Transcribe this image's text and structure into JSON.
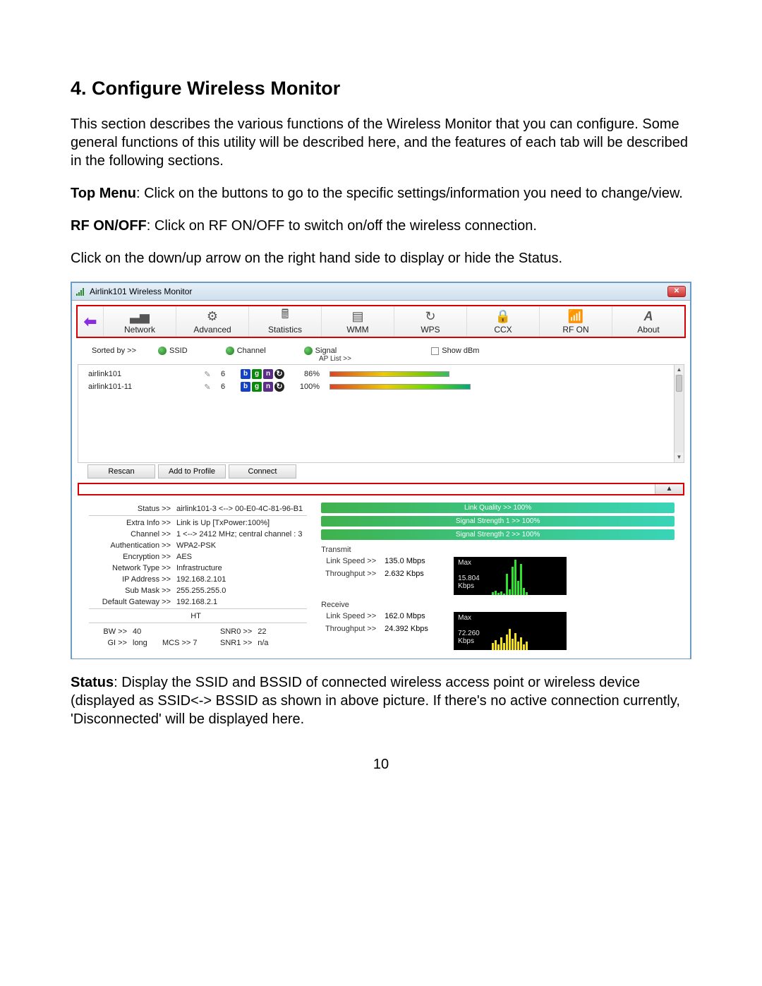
{
  "page": {
    "heading": "4. Configure Wireless Monitor",
    "p1": "This section describes the various functions of the Wireless Monitor that you can configure. Some general functions of this utility will be described here, and the features of each tab will be described in the following sections.",
    "p2_b": "Top Menu",
    "p2": ": Click on the buttons to go to the specific settings/information you need to change/view.",
    "p3_b": "RF ON/OFF",
    "p3": ": Click on RF ON/OFF to switch on/off the wireless connection.",
    "p4": "Click on the down/up arrow on the right hand side to display or hide the Status.",
    "p5_b": "Status",
    "p5": ": Display the SSID and BSSID of connected wireless access point or wireless device (displayed as SSID<-> BSSID as shown in above picture. If there's no active connection currently, 'Disconnected' will be displayed here.",
    "page_number": "10"
  },
  "app": {
    "title": "Airlink101 Wireless Monitor",
    "close": "✕",
    "back": "⬅",
    "toolbar": {
      "network": "Network",
      "advanced": "Advanced",
      "statistics": "Statistics",
      "wmm": "WMM",
      "wps": "WPS",
      "ccx": "CCX",
      "rfon": "RF ON",
      "about": "About"
    },
    "sort": {
      "label": "Sorted by >>",
      "ssid": "SSID",
      "channel": "Channel",
      "signal": "Signal",
      "show_dbm": "Show dBm",
      "aplist": "AP List >>"
    },
    "ap": [
      {
        "ssid": "airlink101",
        "ch": "6",
        "pct": "86%"
      },
      {
        "ssid": "airlink101-11",
        "ch": "6",
        "pct": "100%"
      }
    ],
    "btns": {
      "rescan": "Rescan",
      "add": "Add to Profile",
      "connect": "Connect"
    },
    "collapse": "▲",
    "status": {
      "status_k": "Status >>",
      "status_v": "airlink101-3 <--> 00-E0-4C-81-96-B1",
      "extra_k": "Extra Info >>",
      "extra_v": "Link is Up [TxPower:100%]",
      "channel_k": "Channel >>",
      "channel_v": "1 <--> 2412 MHz; central channel : 3",
      "auth_k": "Authentication >>",
      "auth_v": "WPA2-PSK",
      "enc_k": "Encryption >>",
      "enc_v": "AES",
      "net_k": "Network Type >>",
      "net_v": "Infrastructure",
      "ip_k": "IP Address >>",
      "ip_v": "192.168.2.101",
      "mask_k": "Sub Mask >>",
      "mask_v": "255.255.255.0",
      "gw_k": "Default Gateway >>",
      "gw_v": "192.168.2.1",
      "ht": "HT",
      "bw_k": "BW >>",
      "bw_v": "40",
      "gi_k": "GI >>",
      "gi_v": "long",
      "mcs_k": "MCS >>",
      "mcs_v": "7",
      "snr0_k": "SNR0 >>",
      "snr0_v": "22",
      "snr1_k": "SNR1 >>",
      "snr1_v": "n/a"
    },
    "quality": {
      "link": "Link Quality >> 100%",
      "s1": "Signal Strength 1 >> 100%",
      "s2": "Signal Strength 2 >> 100%"
    },
    "transmit": {
      "label": "Transmit",
      "ls_k": "Link Speed >>",
      "ls_v": "135.0 Mbps",
      "tp_k": "Throughput >>",
      "tp_v": "2.632 Kbps",
      "chart_top": "Max",
      "chart_val": "15.804",
      "chart_unit": "Kbps"
    },
    "receive": {
      "label": "Receive",
      "ls_k": "Link Speed >>",
      "ls_v": "162.0 Mbps",
      "tp_k": "Throughput >>",
      "tp_v": "24.392 Kbps",
      "chart_top": "Max",
      "chart_val": "72.260",
      "chart_unit": "Kbps"
    }
  }
}
